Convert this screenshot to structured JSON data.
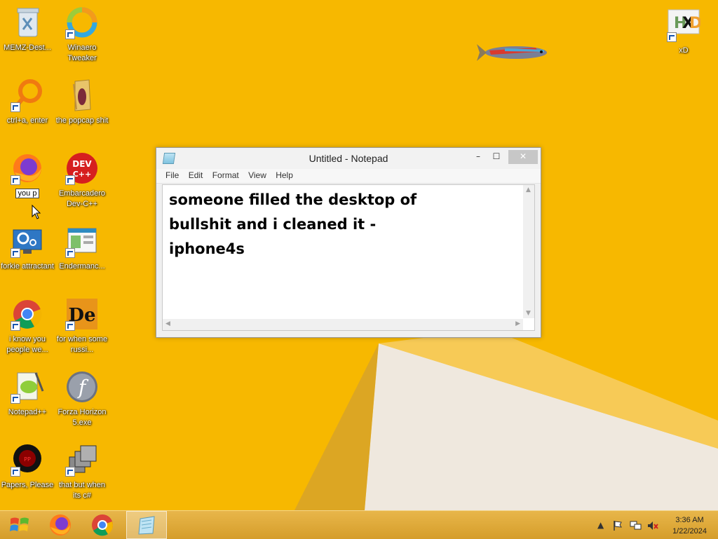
{
  "desktop": {
    "icons": [
      {
        "label": "MEMZ-Dest...",
        "icon": "recycle-bin-icon"
      },
      {
        "label": "Winaero Tweaker",
        "icon": "winaero-icon"
      },
      {
        "label": "ctrl+a, enter",
        "icon": "magnifier-ring-icon"
      },
      {
        "label": "the popcap shit",
        "icon": "folder-icon"
      },
      {
        "label": "you p",
        "icon": "firefox-icon"
      },
      {
        "label": "Embarcadero Dev-C++",
        "icon": "devcpp-icon"
      },
      {
        "label": "forkie attractant",
        "icon": "settings-monitor-icon"
      },
      {
        "label": "Endermanc...",
        "icon": "window-app-icon"
      },
      {
        "label": "i know you people we...",
        "icon": "chrome-icon"
      },
      {
        "label": "for when some russi...",
        "icon": "de-app-icon"
      },
      {
        "label": "Notepad++",
        "icon": "notepadpp-icon"
      },
      {
        "label": "Forza Horizon 5.exe",
        "icon": "flash-icon"
      },
      {
        "label": "Papers, Please",
        "icon": "papers-please-icon"
      },
      {
        "label": "that but when its c#",
        "icon": "windows-stack-icon"
      },
      {
        "label": "xD",
        "icon": "hxd-icon"
      }
    ]
  },
  "notepad": {
    "title": "Untitled - Notepad",
    "menu": [
      "File",
      "Edit",
      "Format",
      "View",
      "Help"
    ],
    "content": "someone filled the desktop of\nbullshit and i cleaned it -\niphone4s",
    "close_glyph": "✕",
    "min_glyph": "–",
    "max_glyph": "☐"
  },
  "taskbar": {
    "pinned": [
      "start-button",
      "firefox",
      "chrome",
      "notepad"
    ],
    "time": "3:36 AM",
    "date": "1/22/2024"
  },
  "colors": {
    "desktop_bg": "#f7b800",
    "taskbar": "#dba535"
  }
}
